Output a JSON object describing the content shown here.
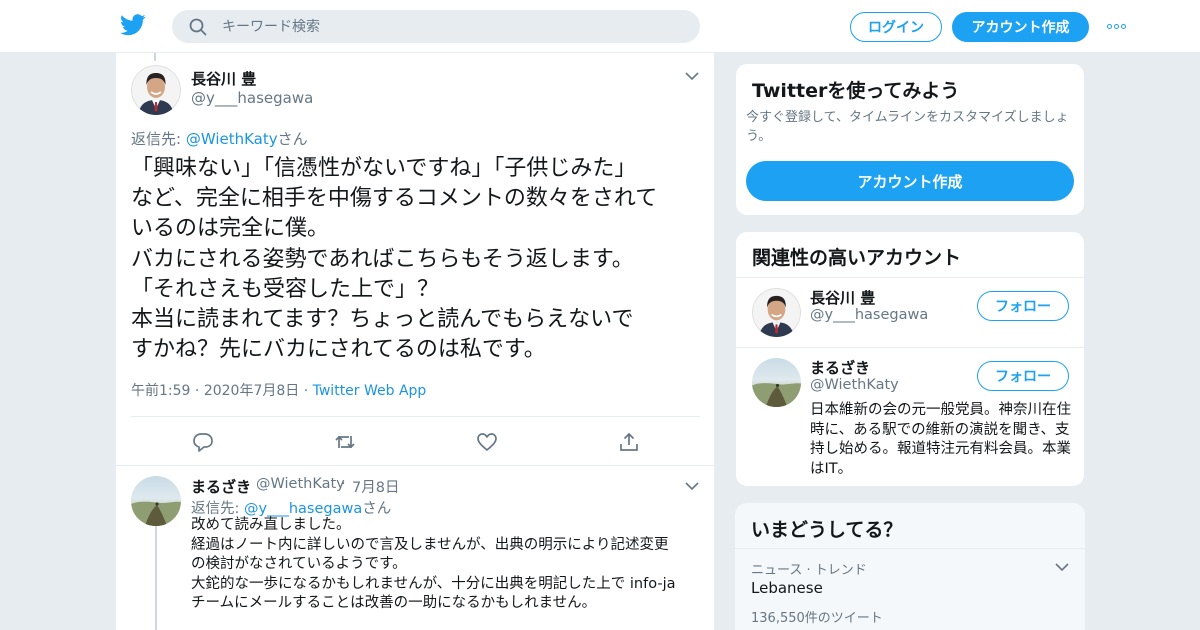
{
  "header": {
    "search_placeholder": "キーワード検索",
    "login_label": "ログイン",
    "signup_label": "アカウント作成",
    "brand_color": "#1da1f2"
  },
  "main_tweet": {
    "name": "長谷川 豊",
    "handle": "@y___hasegawa",
    "reply_prefix": "返信先: ",
    "reply_to": "@WiethKaty",
    "reply_suffix": "さん",
    "text": "「興味ない」「信憑性がないですね」「子供じみた」\nなど、完全に相手を中傷するコメントの数々をされて\nいるのは完全に僕。\nバカにされる姿勢であればこちらもそう返します。\n「それさえも受容した上で」？\n本当に読まれてます？ちょっと読んでもらえないで\nすかね？先にバカにされてるのは私です。",
    "time": "午前1:59",
    "date": "2020年7月8日",
    "source": "Twitter Web App",
    "actions": [
      "reply-icon",
      "retweet-icon",
      "like-icon",
      "share-icon"
    ]
  },
  "reply_tweet": {
    "name": "まるざき",
    "handle": "@WiethKaty",
    "date": "7月8日",
    "reply_prefix": "返信先: ",
    "reply_to": "@y___hasegawa",
    "reply_suffix": "さん",
    "text": "改めて読み直しました。\n経過はノート内に詳しいので言及しませんが、出典の明示により記述変更\nの検討がなされているようです。\n大鉈的な一歩になるかもしれませんが、十分に出典を明記した上で info-ja\nチームにメールすることは改善の一助になるかもしれません。"
  },
  "try_card": {
    "title": "Twitterを使ってみよう",
    "description": "今すぐ登録して、タイムラインをカスタマイズしましょう。",
    "button_label": "アカウント作成"
  },
  "related": {
    "title": "関連性の高いアカウント",
    "accounts": [
      {
        "name": "長谷川 豊",
        "handle": "@y___hasegawa",
        "follow_label": "フォロー"
      },
      {
        "name": "まるざき",
        "handle": "@WiethKaty",
        "follow_label": "フォロー",
        "bio": "日本維新の会の元一般党員。神奈川在住時に、ある駅での維新の演説を聞き、支持し始める。報道特注元有料会員。本業はIT。"
      }
    ]
  },
  "trends": {
    "title": "いまどうしてる？",
    "items": [
      {
        "context": "ニュース · トレンド",
        "name": "Lebanese",
        "count": "136,550件のツイート"
      }
    ]
  }
}
